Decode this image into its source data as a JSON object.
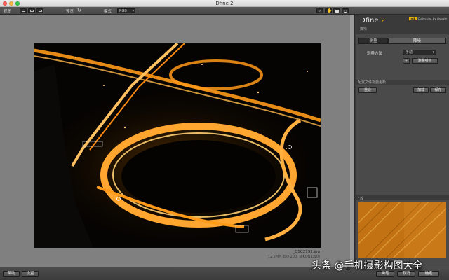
{
  "window": {
    "title": "Dfine 2"
  },
  "toolbar": {
    "view_label": "视图",
    "preview_label": "预览",
    "mode_label": "模式",
    "mode_value": "RGB"
  },
  "canvas": {
    "file_name": "_DSC2192.jpg",
    "file_info": "(12.2MP, ISO 200, NIKON D90)"
  },
  "panel": {
    "brand": "Dfine",
    "version": "2",
    "nik_badge": "nik",
    "collection_text": "Collection by Google",
    "section_title": "降噪",
    "seg_measure": "测量",
    "seg_reduce": "降噪",
    "method_label": "测量方法",
    "method_value": "手动",
    "add_point_button": "测量噪点",
    "profile_bar": "配置文件需要更新",
    "reset_button": "重设",
    "load_button": "加载",
    "save_button": "保存",
    "loupe_label": "放大镜"
  },
  "bottom": {
    "help_button": "帮助",
    "settings_button": "设置",
    "brush_button": "画笔",
    "cancel_button": "取消",
    "ok_button": "确定"
  },
  "watermark": "头条 @手机摄影构图大全",
  "colors": {
    "accent": "#e8b400",
    "light_trail": "#ff9a1a"
  }
}
